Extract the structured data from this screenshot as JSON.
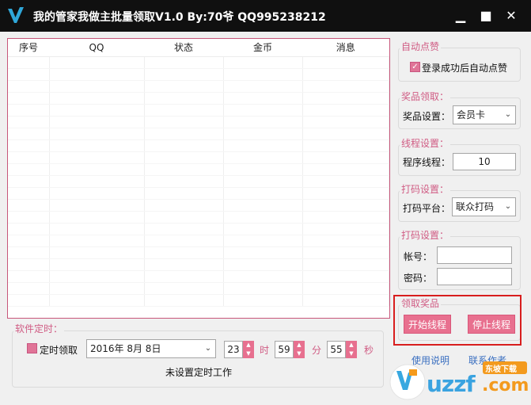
{
  "window": {
    "title": "我的管家我做主批量领取V1.0 By:70爷 QQ995238212",
    "logo_letter": "V",
    "minimize": "▁",
    "maximize": "■",
    "close": "✕"
  },
  "table": {
    "columns": [
      "序号",
      "QQ",
      "状态",
      "金币",
      "消息"
    ],
    "empty_rows": 21
  },
  "auto_like": {
    "group_title": "自动点赞",
    "checkbox_label": "登录成功后自动点赞",
    "checked": true,
    "check_glyph": "✓"
  },
  "prize": {
    "group_title": "奖品领取：",
    "label": "奖品设置：",
    "value": "会员卡"
  },
  "thread": {
    "group_title": "线程设置：",
    "label": "程序线程：",
    "value": "10"
  },
  "captcha_platform": {
    "group_title": "打码设置：",
    "label": "打码平台：",
    "value": "联众打码"
  },
  "captcha_account": {
    "group_title": "打码设置：",
    "account_label": "帐号：",
    "password_label": "密码：",
    "account_value": "",
    "password_value": ""
  },
  "claim": {
    "group_title": "领取奖品",
    "start_button": "开始线程",
    "stop_button": "停止线程"
  },
  "timer": {
    "group_title": "软件定时：",
    "checkbox_label": "定时领取",
    "checked": false,
    "date_value": "2016年  8月  8日",
    "hour": "23",
    "hour_unit": "时",
    "minute": "59",
    "minute_unit": "分",
    "second": "55",
    "second_unit": "秒",
    "status": "未设置定时工作",
    "spin_up": "▲",
    "spin_down": "▼",
    "dropdown_arrow": "⌄"
  },
  "footer": {
    "link_left": "使用说明",
    "link_right": "联系作者"
  },
  "watermark": {
    "brand": "uzzf",
    "tld": ".com",
    "badge": "东坡下载"
  },
  "colors": {
    "accent": "#e8708f",
    "title_bar": "#101010",
    "group_title": "#d05c84",
    "highlight_frame": "#d81e1e"
  }
}
